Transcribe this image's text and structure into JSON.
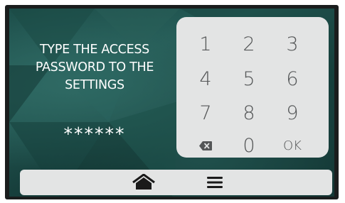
{
  "prompt": {
    "text": "TYPE THE ACCESS\nPASSWORD TO THE\nSETTINGS"
  },
  "password": {
    "masked": "******"
  },
  "keypad": {
    "keys": [
      "1",
      "2",
      "3",
      "4",
      "5",
      "6",
      "7",
      "8",
      "9",
      "backspace-icon",
      "0",
      "OK"
    ]
  },
  "navbar": {
    "icons": [
      "home-icon",
      "menu-icon"
    ]
  },
  "colors": {
    "background_teal": "#1e4f4b",
    "panel": "#e3e4e4",
    "key_text": "#545657",
    "text": "#ffffff"
  }
}
